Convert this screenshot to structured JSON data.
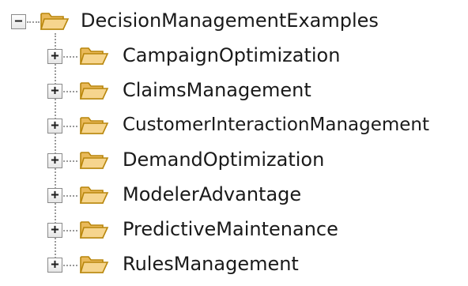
{
  "tree": {
    "root": {
      "label": "DecisionManagementExamples",
      "state": "expanded",
      "icon": "open-folder-icon"
    },
    "children": [
      {
        "label": "CampaignOptimization",
        "state": "collapsed",
        "icon": "open-folder-icon"
      },
      {
        "label": "ClaimsManagement",
        "state": "collapsed",
        "icon": "open-folder-icon"
      },
      {
        "label": "CustomerInteractionManagement",
        "state": "collapsed",
        "icon": "open-folder-icon"
      },
      {
        "label": "DemandOptimization",
        "state": "collapsed",
        "icon": "open-folder-icon"
      },
      {
        "label": "ModelerAdvantage",
        "state": "collapsed",
        "icon": "open-folder-icon"
      },
      {
        "label": "PredictiveMaintenance",
        "state": "collapsed",
        "icon": "open-folder-icon"
      },
      {
        "label": "RulesManagement",
        "state": "collapsed",
        "icon": "open-folder-icon"
      }
    ],
    "expand_glyph": "+",
    "collapse_glyph": "−",
    "colors": {
      "folder_fill": "#f6d58e",
      "folder_stroke": "#b8860b",
      "text": "#1a1a1a",
      "tree_line": "#9a9a9a"
    }
  }
}
